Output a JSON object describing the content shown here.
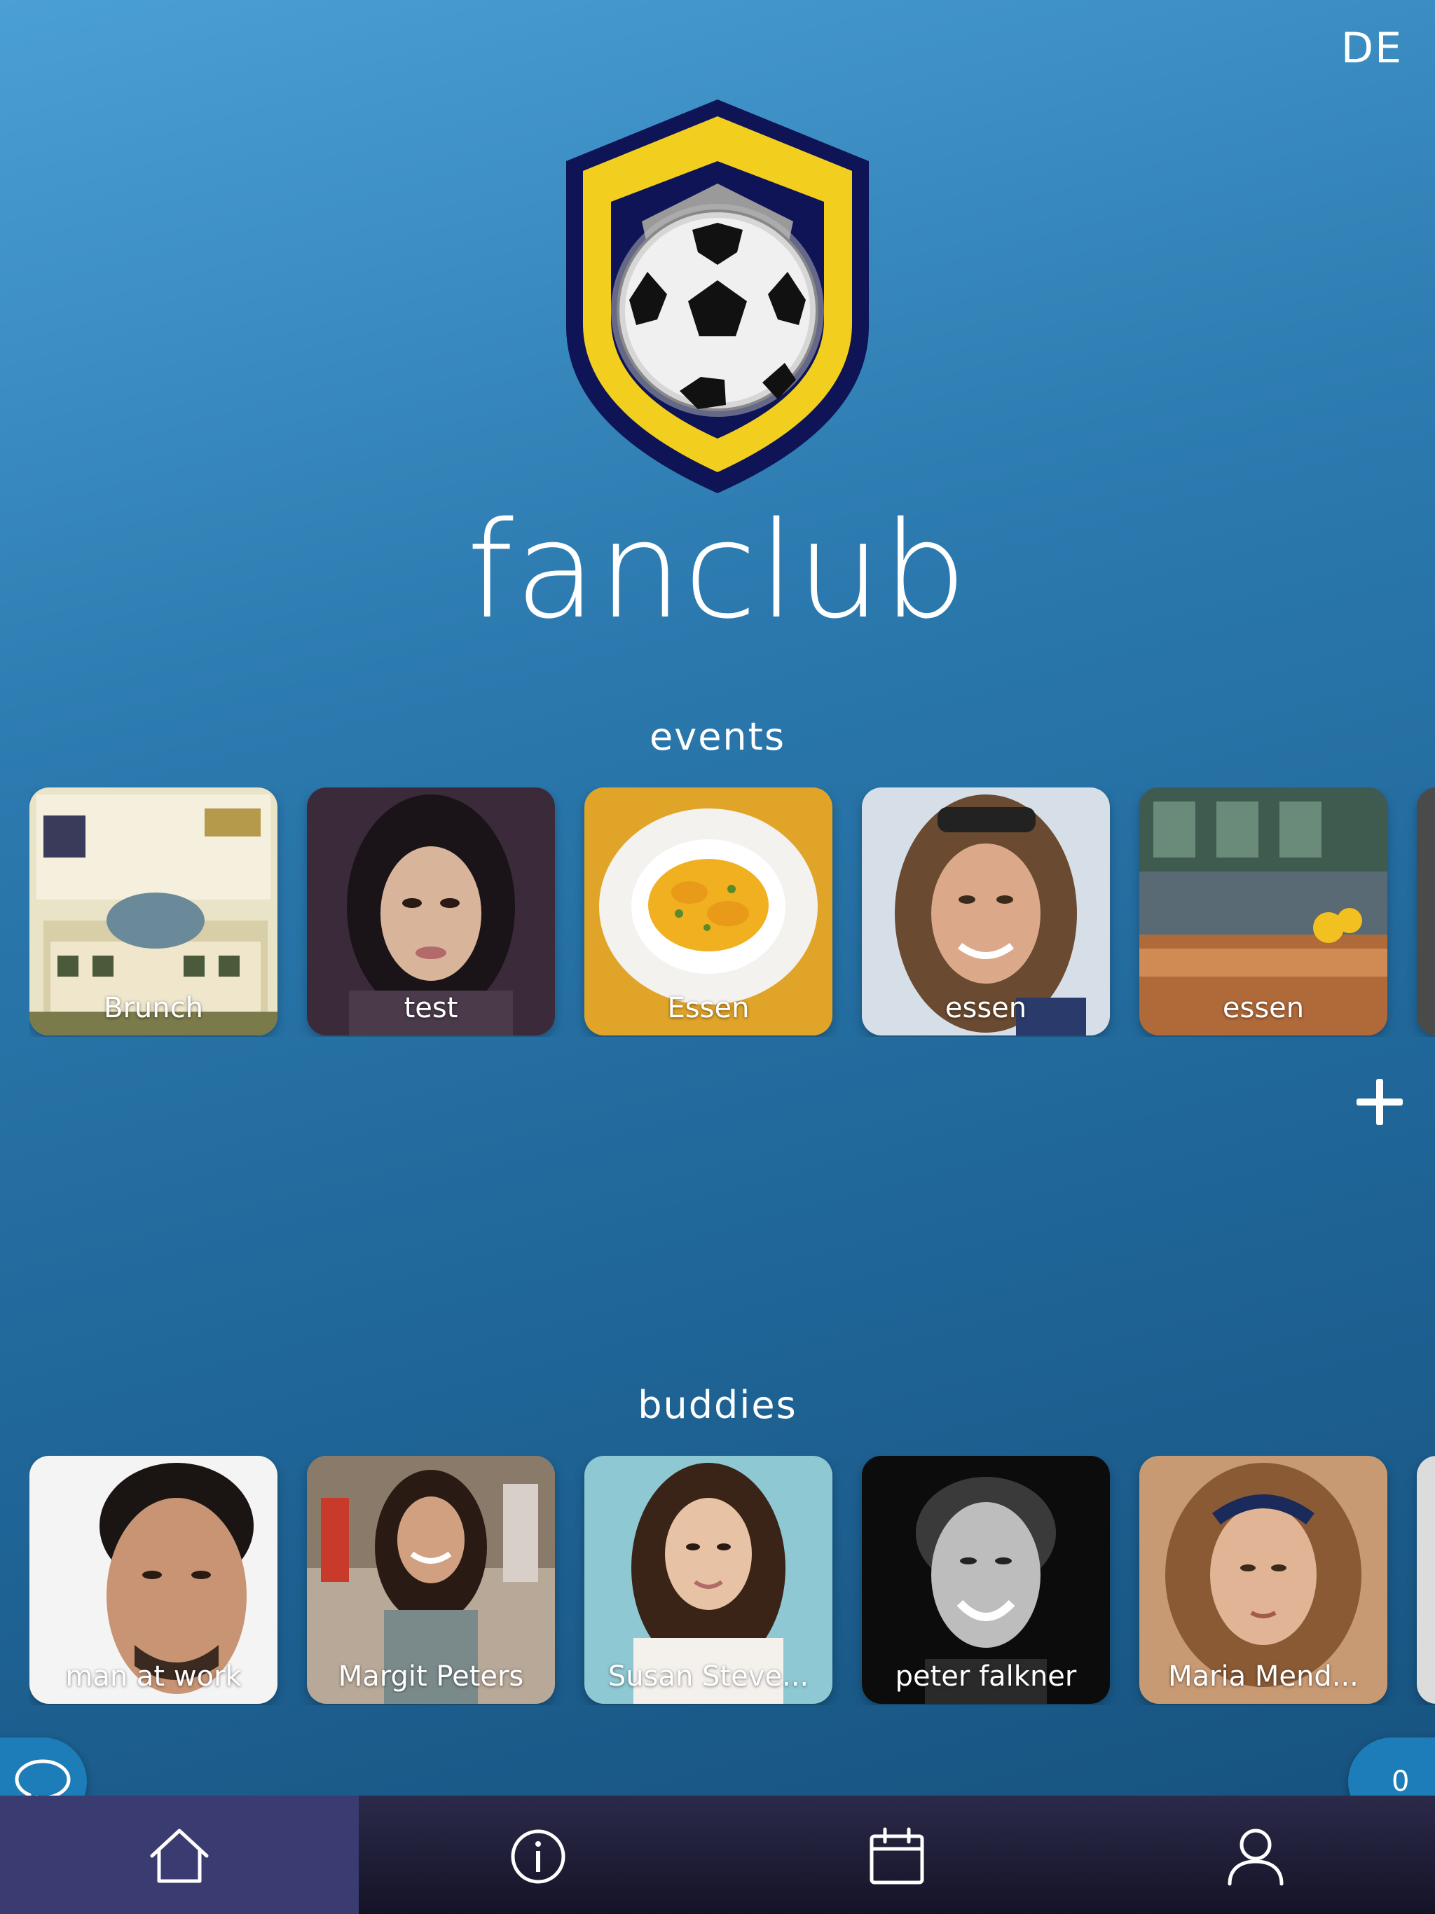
{
  "header": {
    "language": "DE",
    "app_title": "fanclub"
  },
  "events": {
    "title": "events",
    "items": [
      {
        "label": "Brunch"
      },
      {
        "label": "test"
      },
      {
        "label": "Essen"
      },
      {
        "label": "essen"
      },
      {
        "label": "essen"
      }
    ]
  },
  "buddies": {
    "title": "buddies",
    "items": [
      {
        "label": "man at work"
      },
      {
        "label": "Margit Peters"
      },
      {
        "label": "Susan Steve..."
      },
      {
        "label": "peter falkner"
      },
      {
        "label": "Maria Mend..."
      }
    ]
  },
  "floating": {
    "counter": "0"
  },
  "tabbar": {
    "tabs": [
      {
        "icon": "home-icon",
        "active": true
      },
      {
        "icon": "info-icon",
        "active": false
      },
      {
        "icon": "calendar-icon",
        "active": false
      },
      {
        "icon": "user-icon",
        "active": false
      }
    ]
  },
  "colors": {
    "background_top": "#4a9fd4",
    "background_bottom": "#16507c",
    "tabbar": "#141326",
    "tab_active": "#3a3b70",
    "badge": "#1d7db8",
    "shield_yellow": "#f2cf1f",
    "shield_navy": "#0e1455"
  }
}
